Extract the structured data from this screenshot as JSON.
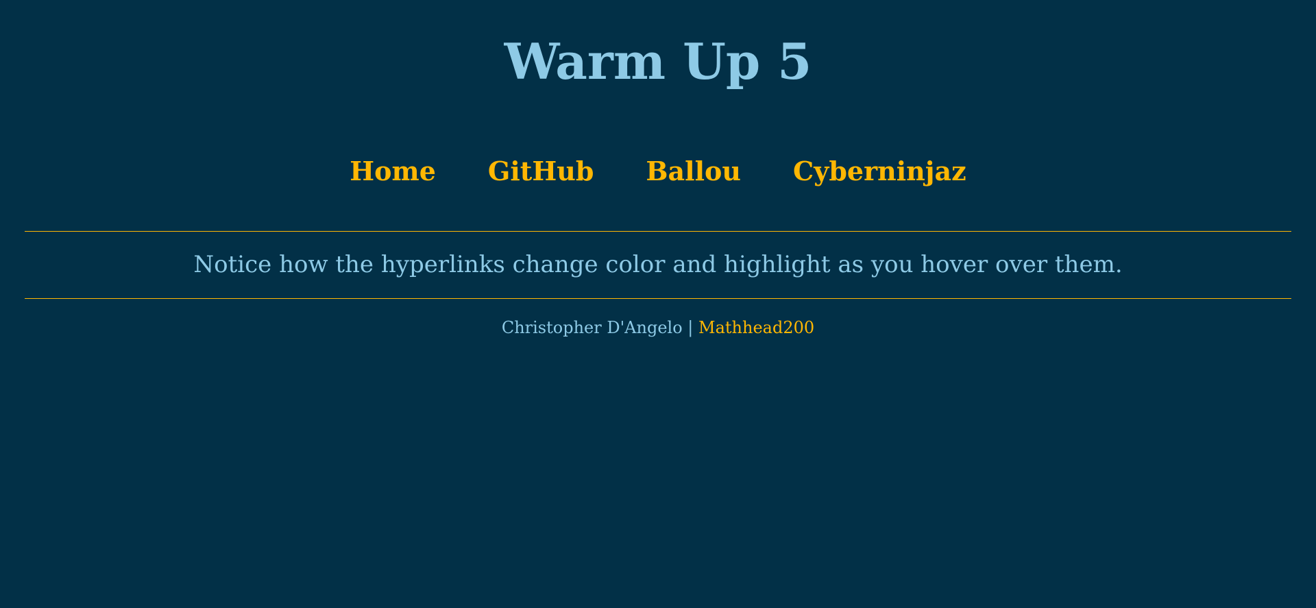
{
  "page": {
    "title": "Warm Up 5"
  },
  "nav": {
    "items": [
      {
        "label": "Home"
      },
      {
        "label": "GitHub"
      },
      {
        "label": "Ballou"
      },
      {
        "label": "Cyberninjaz"
      }
    ]
  },
  "main": {
    "notice": "Notice how the hyperlinks change color and highlight as you hover over them."
  },
  "footer": {
    "author": "Christopher D'Angelo",
    "separator": "|",
    "handle_link": "Mathhead200"
  },
  "colors": {
    "background": "#023047",
    "text": "#8ecae6",
    "accent": "#ffb703"
  }
}
